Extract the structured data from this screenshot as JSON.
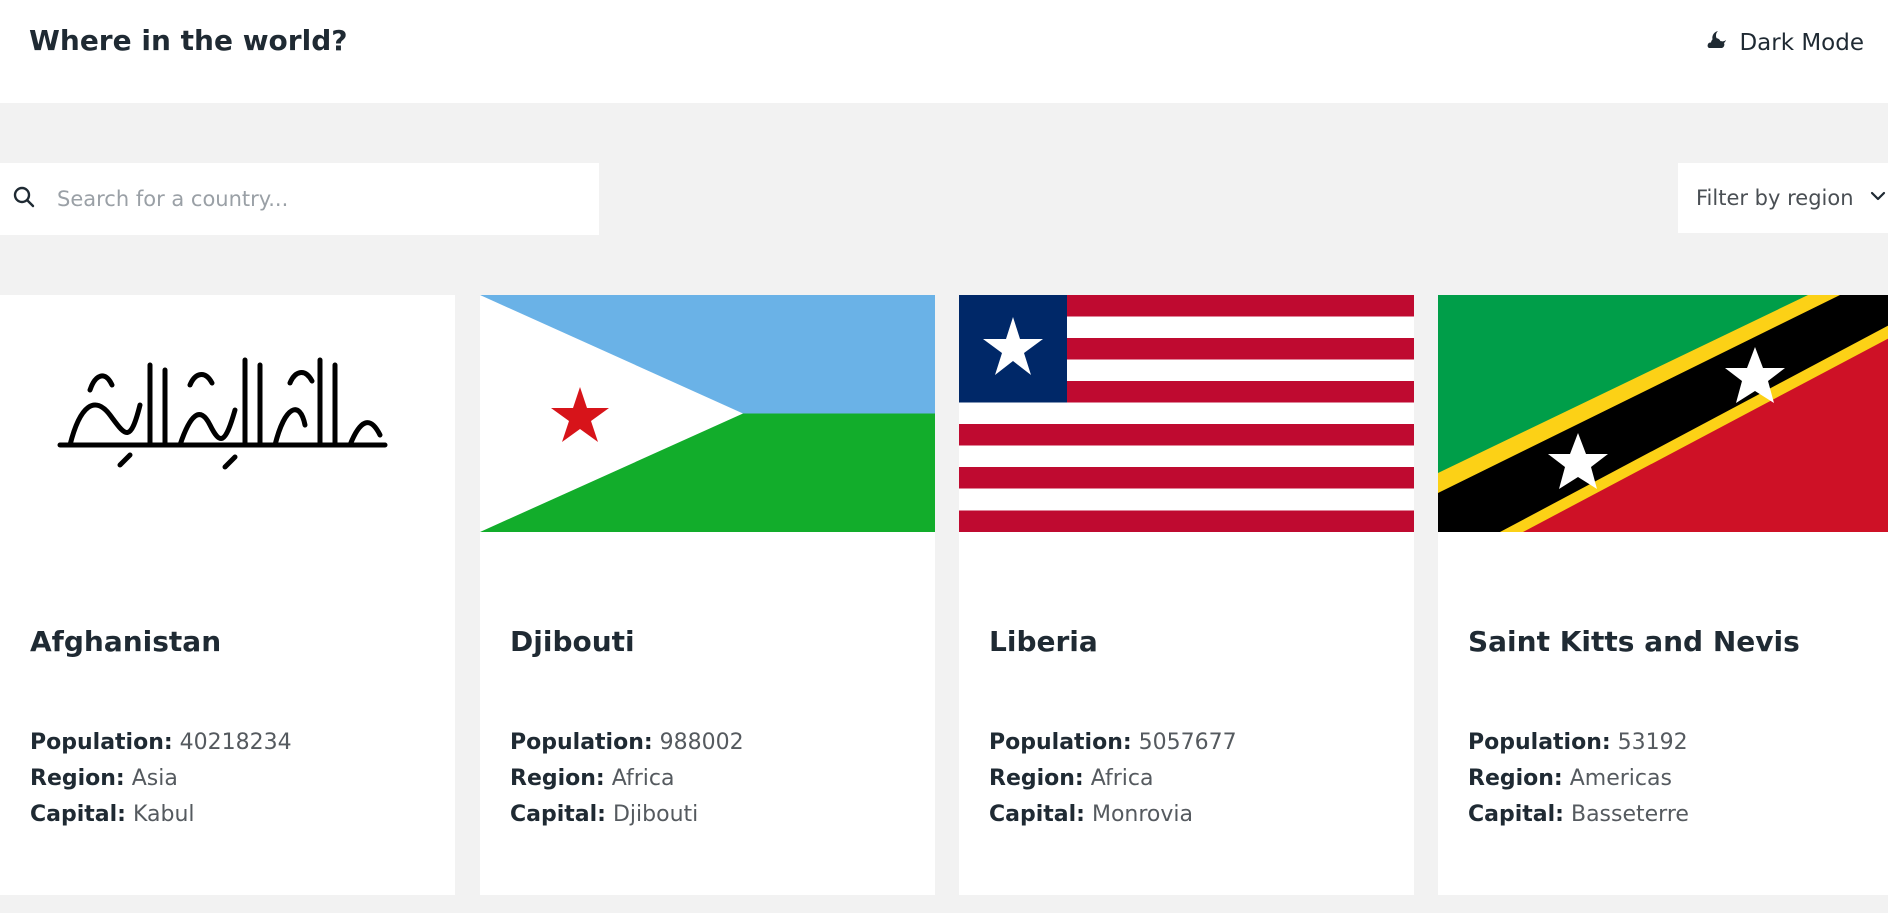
{
  "header": {
    "title": "Where in the world?",
    "theme_toggle_label": "Dark Mode",
    "theme_toggle_icon": "moon-cloud-icon"
  },
  "search": {
    "placeholder": "Search for a country...",
    "value": "",
    "icon": "search-icon"
  },
  "filter": {
    "label": "Filter by region",
    "icon": "chevron-down-icon"
  },
  "labels": {
    "population": "Population:",
    "region": "Region:",
    "capital": "Capital:"
  },
  "countries": [
    {
      "name": "Afghanistan",
      "population": "40218234",
      "region": "Asia",
      "capital": "Kabul",
      "flag": "afghanistan-flag"
    },
    {
      "name": "Djibouti",
      "population": "988002",
      "region": "Africa",
      "capital": "Djibouti",
      "flag": "djibouti-flag"
    },
    {
      "name": "Liberia",
      "population": "5057677",
      "region": "Africa",
      "capital": "Monrovia",
      "flag": "liberia-flag"
    },
    {
      "name": "Saint Kitts and Nevis",
      "population": "53192",
      "region": "Americas",
      "capital": "Basseterre",
      "flag": "saint-kitts-and-nevis-flag"
    }
  ],
  "colors": {
    "background": "#f2f2f2",
    "surface": "#ffffff",
    "text": "#1f2a33",
    "muted": "#555a5f"
  }
}
